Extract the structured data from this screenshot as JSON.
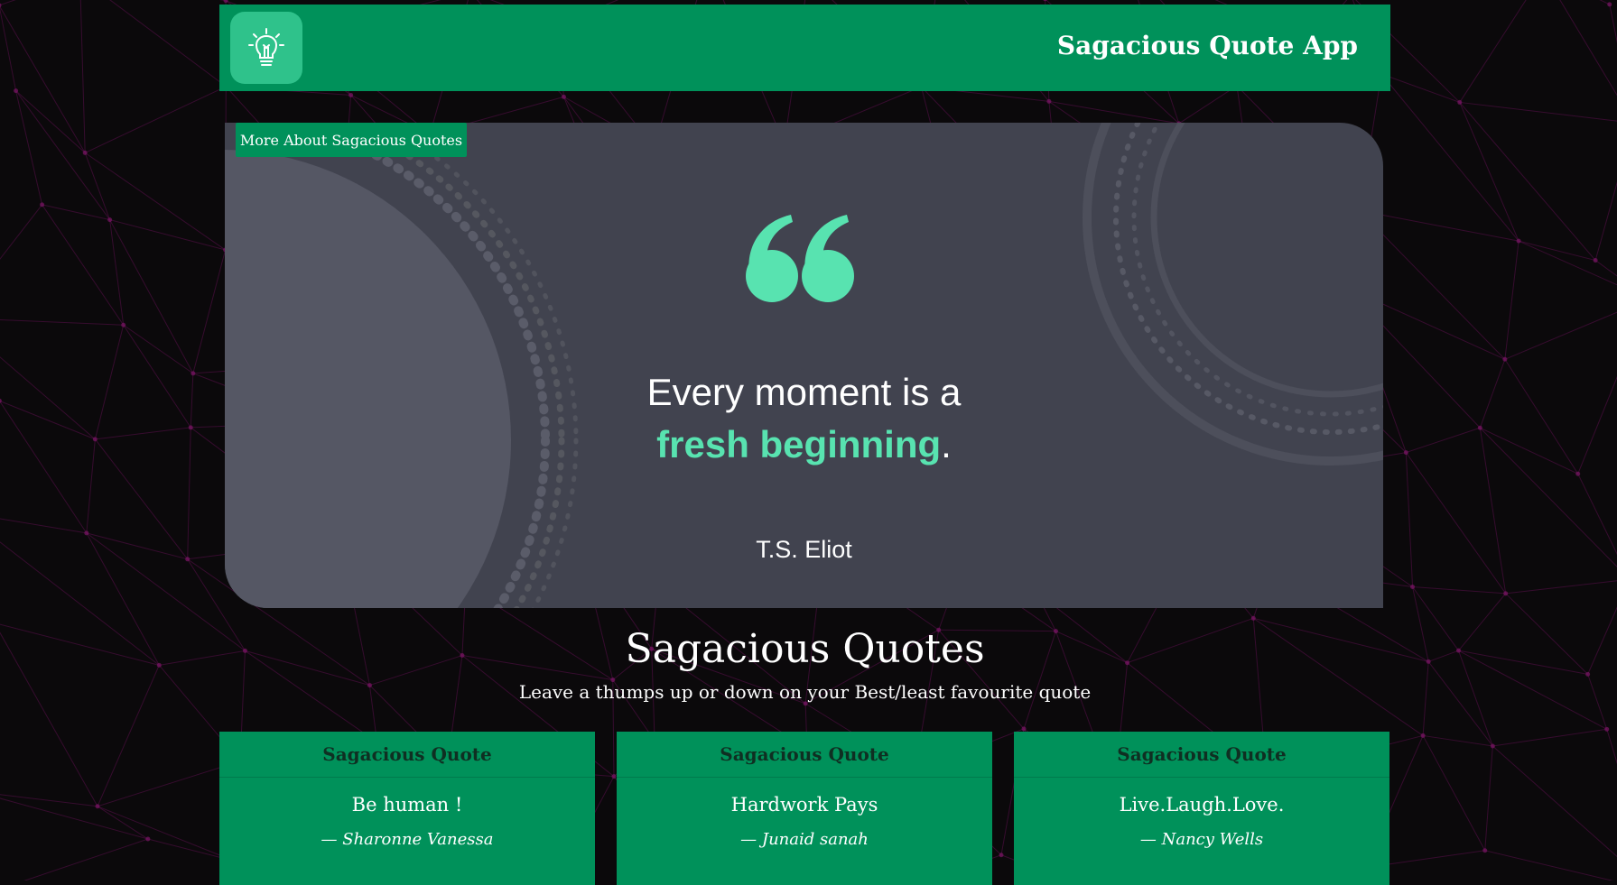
{
  "navbar": {
    "title": "Sagacious Quote App",
    "logo_icon": "lightbulb-icon"
  },
  "hero": {
    "more_button": "More About Sagacious Quotes",
    "quote_icon": "quote-marks-icon",
    "quote_line1": "Every moment is a",
    "quote_highlight": "fresh beginning",
    "quote_end": ".",
    "author": "T.S. Eliot"
  },
  "section": {
    "title": "Sagacious Quotes",
    "subtitle": "Leave a thumps up or down on your Best/least favourite quote"
  },
  "cards": [
    {
      "header": "Sagacious Quote",
      "quote": "Be human !",
      "author": "— Sharonne Vanessa"
    },
    {
      "header": "Sagacious Quote",
      "quote": "Hardwork Pays",
      "author": "— Junaid sanah"
    },
    {
      "header": "Sagacious Quote",
      "quote": "Live.Laugh.Love.",
      "author": "— Nancy Wells"
    }
  ],
  "colors": {
    "brand_green": "#00915a",
    "accent_mint": "#58e3b0",
    "hero_bg": "#41434f",
    "page_bg": "#0b090b",
    "network_lines": "#5a0f4c"
  }
}
